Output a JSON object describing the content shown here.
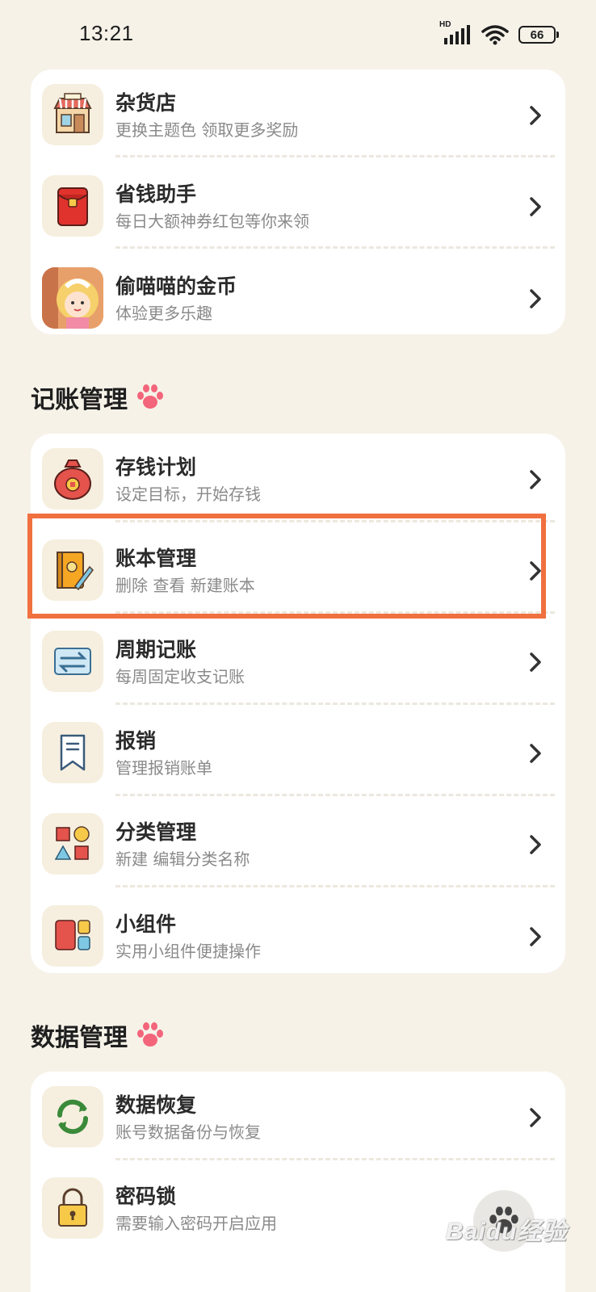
{
  "status_bar": {
    "time": "13:21",
    "network": "HD",
    "battery": "66"
  },
  "top_card": {
    "items": [
      {
        "title": "杂货店",
        "subtitle": "更换主题色 领取更多奖励",
        "icon": "shop-icon"
      },
      {
        "title": "省钱助手",
        "subtitle": "每日大额神券红包等你来领",
        "icon": "red-envelope-icon"
      },
      {
        "title": "偷喵喵的金币",
        "subtitle": "体验更多乐趣",
        "icon": "cartoon-girl-icon"
      }
    ]
  },
  "section_accounting": {
    "title": "记账管理",
    "items": [
      {
        "title": "存钱计划",
        "subtitle": "设定目标，开始存钱",
        "icon": "money-bag-icon"
      },
      {
        "title": "账本管理",
        "subtitle": "删除 查看 新建账本",
        "icon": "ledger-book-icon"
      },
      {
        "title": "周期记账",
        "subtitle": "每周固定收支记账",
        "icon": "cycle-arrows-icon"
      },
      {
        "title": "报销",
        "subtitle": "管理报销账单",
        "icon": "bookmark-icon"
      },
      {
        "title": "分类管理",
        "subtitle": "新建 编辑分类名称",
        "icon": "shapes-icon"
      },
      {
        "title": "小组件",
        "subtitle": "实用小组件便捷操作",
        "icon": "widget-icon"
      }
    ]
  },
  "section_data": {
    "title": "数据管理",
    "items": [
      {
        "title": "数据恢复",
        "subtitle": "账号数据备份与恢复",
        "icon": "refresh-icon"
      },
      {
        "title": "密码锁",
        "subtitle": "需要输入密码开启应用",
        "icon": "lock-icon"
      }
    ]
  },
  "watermark": "Baidu经验",
  "colors": {
    "background": "#f6f2e8",
    "card": "#ffffff",
    "icon_bg": "#f6efdf",
    "highlight": "#f0703f",
    "paw": "#f2657a"
  }
}
